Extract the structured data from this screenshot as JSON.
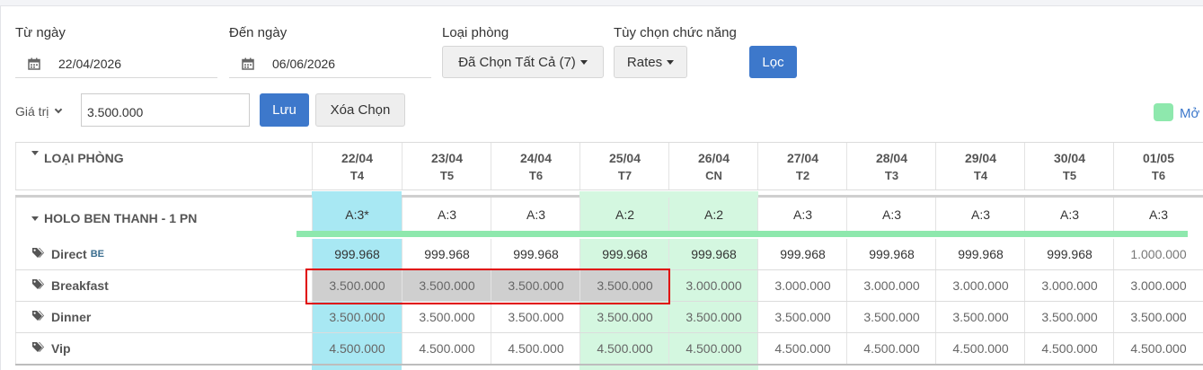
{
  "filters": {
    "from_label": "Từ ngày",
    "from_value": "22/04/2026",
    "to_label": "Đến ngày",
    "to_value": "06/06/2026",
    "room_type_label": "Loại phòng",
    "room_type_value": "Đã Chọn Tất Cả (7)",
    "function_label": "Tùy chọn chức năng",
    "function_value": "Rates",
    "filter_button": "Lọc"
  },
  "value_bar": {
    "select_label": "Giá trị",
    "input_value": "3.500.000",
    "save_button": "Lưu",
    "clear_button": "Xóa Chọn"
  },
  "legend": {
    "label": "Mở",
    "color": "#8ee8ad"
  },
  "grid": {
    "header_label": "LOẠI PHÒNG",
    "dates": [
      {
        "date": "22/04",
        "weekday": "T4"
      },
      {
        "date": "23/04",
        "weekday": "T5"
      },
      {
        "date": "24/04",
        "weekday": "T6"
      },
      {
        "date": "25/04",
        "weekday": "T7"
      },
      {
        "date": "26/04",
        "weekday": "CN"
      },
      {
        "date": "27/04",
        "weekday": "T2"
      },
      {
        "date": "28/04",
        "weekday": "T3"
      },
      {
        "date": "29/04",
        "weekday": "T4"
      },
      {
        "date": "30/04",
        "weekday": "T5"
      },
      {
        "date": "01/05",
        "weekday": "T6"
      }
    ],
    "room": {
      "name": "HOLO BEN THANH - 1 PN",
      "availability": [
        "A:3*",
        "A:3",
        "A:3",
        "A:2",
        "A:2",
        "A:3",
        "A:3",
        "A:3",
        "A:3",
        "A:3"
      ]
    },
    "rates": [
      {
        "name": "Direct",
        "badge": "BE",
        "values": [
          "999.968",
          "999.968",
          "999.968",
          "999.968",
          "999.968",
          "999.968",
          "999.968",
          "999.968",
          "999.968",
          "1.000.000"
        ]
      },
      {
        "name": "Breakfast",
        "badge": "",
        "values": [
          "3.500.000",
          "3.500.000",
          "3.500.000",
          "3.500.000",
          "3.000.000",
          "3.000.000",
          "3.000.000",
          "3.000.000",
          "3.000.000",
          "3.000.000"
        ]
      },
      {
        "name": "Dinner",
        "badge": "",
        "values": [
          "3.500.000",
          "3.500.000",
          "3.500.000",
          "3.500.000",
          "3.500.000",
          "3.500.000",
          "3.500.000",
          "3.500.000",
          "3.500.000",
          "3.500.000"
        ]
      },
      {
        "name": "Vip",
        "badge": "",
        "values": [
          "4.500.000",
          "4.500.000",
          "4.500.000",
          "4.500.000",
          "4.500.000",
          "4.500.000",
          "4.500.000",
          "4.500.000",
          "4.500.000",
          "4.500.000"
        ]
      }
    ]
  },
  "colors": {
    "primary": "#3d78cb",
    "today_column": "#a8e8f3",
    "weekend_column": "#d4f7e0",
    "selected_cells": "#cfcfcf",
    "selection_border": "#e00000"
  }
}
